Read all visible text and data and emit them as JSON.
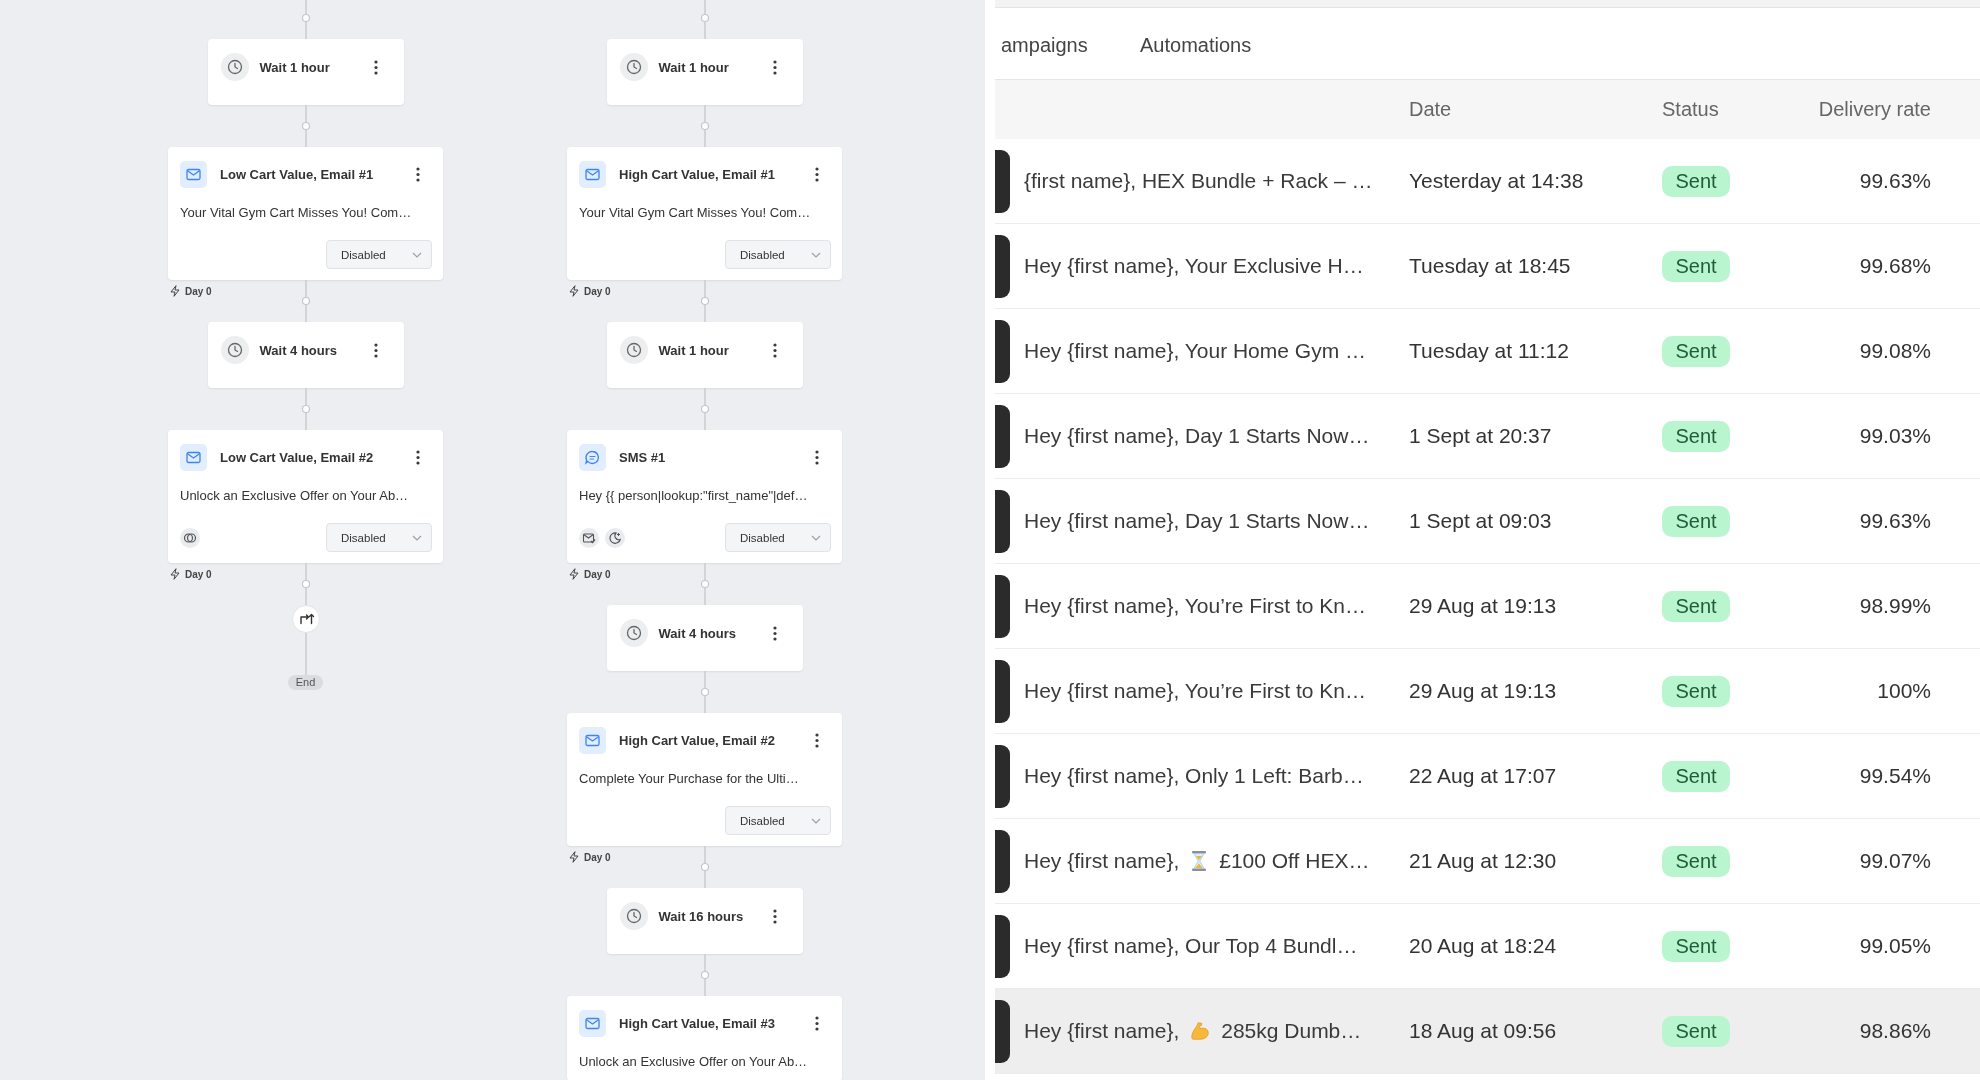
{
  "canvas": {
    "flows": [
      {
        "nodes": [
          {
            "kind": "wait",
            "title": "Wait 1 hour"
          },
          {
            "kind": "email",
            "title": "Low Cart Value, Email #1",
            "preview": "Your Vital Gym Cart Misses You! Com…",
            "status": "Disabled",
            "day": "Day 0"
          },
          {
            "kind": "wait",
            "title": "Wait 4 hours"
          },
          {
            "kind": "email",
            "title": "Low Cart Value, Email #2",
            "preview": "Unlock an Exclusive Offer on Your Ab…",
            "indicators": [
              {
                "kind": "rings"
              }
            ],
            "status": "Disabled",
            "day": "Day 0"
          },
          {
            "kind": "loop"
          },
          {
            "kind": "end",
            "label": "End"
          }
        ]
      },
      {
        "nodes": [
          {
            "kind": "wait",
            "title": "Wait 1 hour"
          },
          {
            "kind": "email",
            "title": "High Cart Value, Email #1",
            "preview": "Your Vital Gym Cart Misses You! Com…",
            "status": "Disabled",
            "day": "Day 0"
          },
          {
            "kind": "wait",
            "title": "Wait 1 hour"
          },
          {
            "kind": "sms",
            "title": "SMS #1",
            "preview": "Hey {{ person|lookup:\"first_name\"|def…",
            "indicators": [
              {
                "kind": "mailcheck"
              },
              {
                "kind": "moon"
              }
            ],
            "status": "Disabled",
            "day": "Day 0"
          },
          {
            "kind": "wait",
            "title": "Wait 4 hours"
          },
          {
            "kind": "email",
            "title": "High Cart Value, Email #2",
            "preview": "Complete Your Purchase for the Ulti…",
            "status": "Disabled",
            "day": "Day 0"
          },
          {
            "kind": "wait",
            "title": "Wait 16 hours"
          },
          {
            "kind": "email",
            "title": "High Cart Value, Email #3",
            "preview": "Unlock an Exclusive Offer on Your Ab…"
          }
        ]
      }
    ]
  },
  "panel": {
    "tabs": [
      {
        "label": "ampaigns",
        "selected": false
      },
      {
        "label": "Automations",
        "selected": false
      }
    ],
    "table": {
      "columns": [
        "Date",
        "Status",
        "Delivery rate"
      ],
      "rows": [
        {
          "subject": "{first name}, HEX Bundle + Rack – …",
          "date": "Yesterday at 14:38",
          "status": "Sent",
          "rate": "99.63%",
          "highlighted": false
        },
        {
          "subject": "Hey {first name}, Your Exclusive H…",
          "date": "Tuesday at 18:45",
          "status": "Sent",
          "rate": "99.68%",
          "highlighted": false
        },
        {
          "subject": "Hey {first name}, Your Home Gym …",
          "date": "Tuesday at 11:12",
          "status": "Sent",
          "rate": "99.08%",
          "highlighted": false
        },
        {
          "subject": "Hey {first name}, Day 1 Starts Now…",
          "date": "1 Sept at 20:37",
          "status": "Sent",
          "rate": "99.03%",
          "highlighted": false
        },
        {
          "subject": "Hey {first name}, Day 1 Starts Now…",
          "date": "1 Sept at 09:03",
          "status": "Sent",
          "rate": "99.63%",
          "highlighted": false
        },
        {
          "subject": "Hey {first name}, You’re First to Kn…",
          "date": "29 Aug at 19:13",
          "status": "Sent",
          "rate": "98.99%",
          "highlighted": false
        },
        {
          "subject": "Hey {first name}, You’re First to Kn…",
          "date": "29 Aug at 19:13",
          "status": "Sent",
          "rate": "100%",
          "highlighted": false
        },
        {
          "subject": "Hey {first name}, Only 1 Left: Barb…",
          "date": "22 Aug at 17:07",
          "status": "Sent",
          "rate": "99.54%",
          "highlighted": false
        },
        {
          "subject": "Hey {first name},",
          "emoji": {
            "kind": "hourglass"
          },
          "subject_end": "£100 Off HEX…",
          "date": "21 Aug at 12:30",
          "status": "Sent",
          "rate": "99.07%",
          "highlighted": false
        },
        {
          "subject": "Hey {first name}, Our Top 4 Bundl…",
          "date": "20 Aug at 18:24",
          "status": "Sent",
          "rate": "99.05%",
          "highlighted": false
        },
        {
          "subject": "Hey {first name},",
          "emoji": {
            "kind": "biceps"
          },
          "subject_end": "285kg Dumb…",
          "date": "18 Aug at 09:56",
          "status": "Sent",
          "rate": "98.86%",
          "highlighted": true
        }
      ]
    }
  }
}
